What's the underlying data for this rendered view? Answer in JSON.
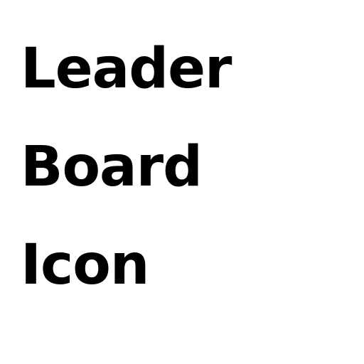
{
  "title_lines": [
    "Leader",
    "Board",
    "Icon"
  ]
}
